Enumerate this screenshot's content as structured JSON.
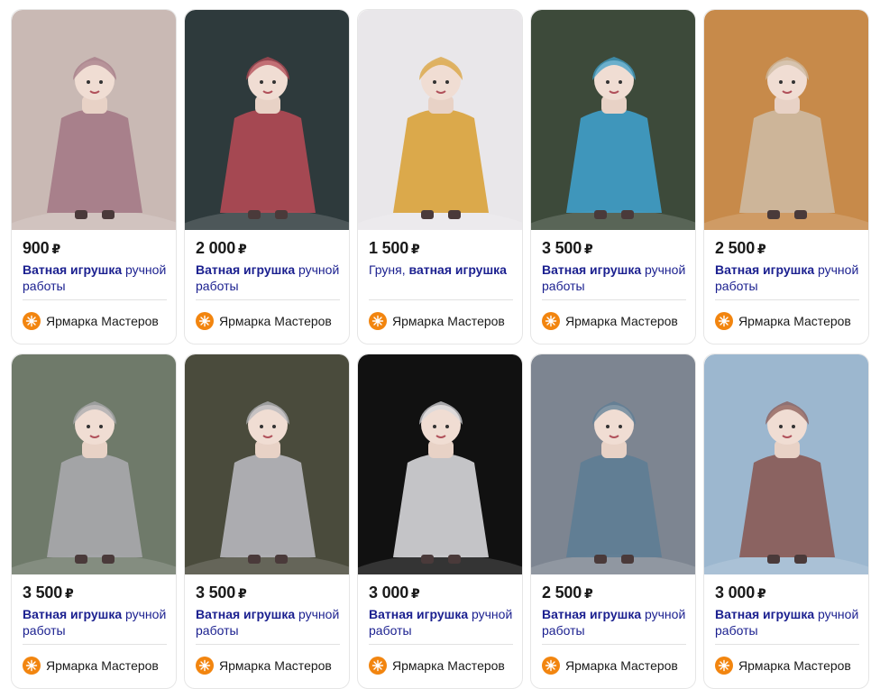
{
  "products": [
    {
      "price": "900",
      "title_bold": "Ватная игрушка",
      "title_rest": " ручной работы",
      "shop": "Ярмарка Мастеров",
      "image": "doll-trio-moon",
      "bg": "#c9b9b4",
      "fg": "#a47a86"
    },
    {
      "price": "2 000",
      "title_bold": "Ватная игрушка",
      "title_rest": " ручной работы",
      "shop": "Ярмарка Мастеров",
      "image": "doll-girl-pink-scarf",
      "bg": "#2e3a3c",
      "fg": "#b34a54"
    },
    {
      "price": "1 500",
      "title_pre": "Груня, ",
      "title_bold": "ватная игрушка",
      "title_rest": "",
      "shop": "Ярмарка Мастеров",
      "image": "doll-girl-yellow-dress",
      "bg": "#e9e7ea",
      "fg": "#d9a23a"
    },
    {
      "price": "3 500",
      "title_bold": "Ватная игрушка",
      "title_rest": " ручной работы",
      "shop": "Ярмарка Мастеров",
      "image": "doll-girl-blue-coat-lantern",
      "bg": "#3d4a3a",
      "fg": "#3f9fca"
    },
    {
      "price": "2 500",
      "title_bold": "Ватная игрушка",
      "title_rest": " ручной работы",
      "shop": "Ярмарка Мастеров",
      "image": "doll-boy-checked-pants",
      "bg": "#c78a4a",
      "fg": "#cdb9a2"
    },
    {
      "price": "3 500",
      "title_bold": "Ватная игрушка",
      "title_rest": " ручной работы",
      "shop": "Ярмарка Мастеров",
      "image": "doll-girl-pink-fur",
      "bg": "#6f7a6a",
      "fg": "#a9a9ad"
    },
    {
      "price": "3 500",
      "title_bold": "Ватная игрушка",
      "title_rest": " ручной работы",
      "shop": "Ярмарка Мастеров",
      "image": "doll-girl-grey-coat",
      "bg": "#4a4b3c",
      "fg": "#b7b7bc"
    },
    {
      "price": "3 000",
      "title_bold": "Ватная игрушка",
      "title_rest": " ручной работы",
      "shop": "Ярмарка Мастеров",
      "image": "doll-child-penguin",
      "bg": "#111111",
      "fg": "#d8d8dc"
    },
    {
      "price": "2 500",
      "title_bold": "Ватная игрушка",
      "title_rest": " ручной работы",
      "shop": "Ярмарка Мастеров",
      "image": "doll-boy-in-hand",
      "bg": "#7d8591",
      "fg": "#5e7d95"
    },
    {
      "price": "3 000",
      "title_bold": "Ватная игрушка",
      "title_rest": " ручной работы",
      "shop": "Ярмарка Мастеров",
      "image": "doll-girl-red-scarf",
      "bg": "#9cb7cf",
      "fg": "#8a5a54"
    }
  ],
  "currency": "₽"
}
